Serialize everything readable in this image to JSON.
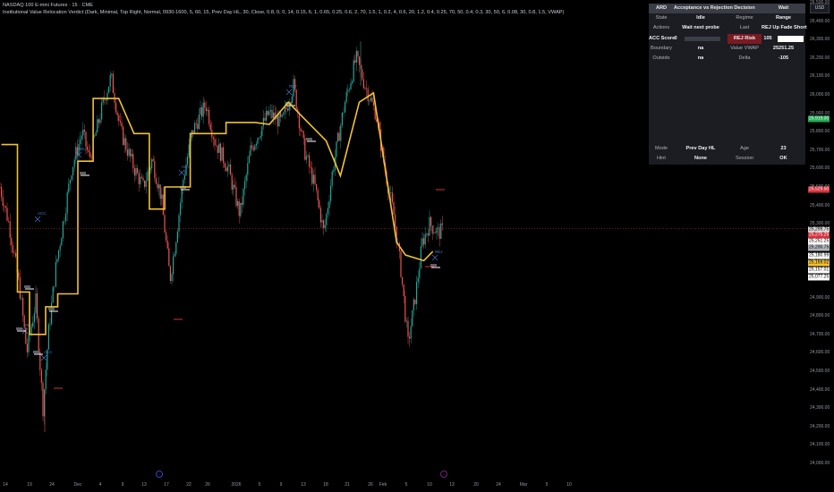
{
  "header": {
    "title": "NASDAQ 100 E-mini Futures · 15 · CME",
    "indicator": "Institutional Value Relocation Verdict (Dark, Minimal, Top Right, Normal, 0930-1600, 5, 60, 15, Prev Day HL, 30, Close, 0.8, 0, 0, 14, 0.15, 6, 1, 0.65, 0.25, 0.6, 2, 70, 1.5, 1, 0.2, 4, 0.6, 20, 1.2, 0.4, 0.25, 70, 50, 0.4, 0.3, 30, 50, 6, 0.08, 30, 0.8, 1.5, VWAP)"
  },
  "currency_button": "USD",
  "table": {
    "headers": [
      "ARD",
      "Acceptance vs Rejection",
      "Decision",
      "Wait"
    ],
    "rows": [
      [
        "State",
        "Idle",
        "Regime",
        "Range"
      ],
      [
        "Actions",
        "Wait next probe",
        "Last",
        "REJ Up  Fade Short"
      ],
      [
        "ACC Score",
        "0",
        "REJ Risk",
        "105"
      ],
      [
        "Boundary",
        "na",
        "Value VWAP",
        "25251.25"
      ],
      [
        "Outside",
        "na",
        "Delta",
        "-105"
      ]
    ],
    "footer_rows": [
      [
        "Mode",
        "Prev Day HL",
        "Age",
        "23"
      ],
      [
        "Hint",
        "None",
        "Session",
        "OK"
      ]
    ]
  },
  "price_axis": {
    "ticks": [
      "26,500.00",
      "26,400.00",
      "26,300.00",
      "26,200.00",
      "26,100.00",
      "26,000.00",
      "25,900.00",
      "25,800.00",
      "25,700.00",
      "25,600.00",
      "25,500.00",
      "25,400.00",
      "25,300.00",
      "25,200.00",
      "25,100.00",
      "25,000.00",
      "24,900.00",
      "24,800.00",
      "24,700.00",
      "24,600.00",
      "24,500.00",
      "24,400.00",
      "24,300.00",
      "24,200.00",
      "24,100.00",
      "24,000.00"
    ],
    "tags": [
      {
        "label": "25,919.00",
        "bg": "#22ab56",
        "fg": "#ffffff"
      },
      {
        "label": "25,529.50",
        "bg": "#d4313c",
        "fg": "#ffffff"
      },
      {
        "label": "25,299.75",
        "bg": "#d9d9d9",
        "fg": "#000000"
      },
      {
        "label": "25,275.25",
        "bg": "#d4313c",
        "fg": "#ffffff"
      },
      {
        "label": "25,251.25",
        "bg": "#ffffff",
        "fg": "#000000"
      },
      {
        "label": "25,200.75",
        "bg": "#b0b3ba",
        "fg": "#000000"
      },
      {
        "label": "25,180.99",
        "bg": "#ffffff",
        "fg": "#000000"
      },
      {
        "label": "25,169.02",
        "bg": "#f1c232",
        "fg": "#000000"
      },
      {
        "label": "25,157.01",
        "bg": "#ffffff",
        "fg": "#000000"
      },
      {
        "label": "25,077.25",
        "bg": "#ffffff",
        "fg": "#000000"
      }
    ]
  },
  "time_axis": [
    "14",
    "19",
    "24",
    "Dec",
    "4",
    "9",
    "13",
    "17",
    "22",
    "26",
    "2026",
    "5",
    "9",
    "13",
    "18",
    "21",
    "26",
    "Feb",
    "5",
    "10",
    "13",
    "20",
    "24",
    "Mar",
    "5",
    "10"
  ],
  "chart_data": {
    "type": "line",
    "symbol": "NQ1!",
    "timeframe": "15",
    "ylim": [
      24000,
      26500
    ],
    "series": [
      {
        "color": "#f1c232",
        "x": [
          "Nov 13",
          "Nov 17",
          "Nov 17",
          "Nov 20",
          "Nov 20",
          "Nov 24",
          "Nov 24",
          "Nov 27",
          "Nov 27",
          "Dec 1",
          "Dec 1",
          "Dec 4",
          "Dec 4",
          "Dec 9",
          "Dec 9",
          "Dec 12",
          "Dec 12",
          "Dec 15",
          "Dec 15",
          "Dec 18",
          "Dec 18",
          "Dec 23",
          "Dec 23",
          "Dec 30",
          "Dec 30",
          "Jan 5",
          "Jan 5",
          "Jan 8",
          "Jan 8",
          "Jan 12",
          "Jan 12",
          "Jan 15",
          "Jan 15",
          "Jan 20",
          "Jan 20",
          "Jan 23",
          "Jan 23",
          "Jan 27",
          "Jan 27",
          "Jan 30",
          "Jan 30",
          "Feb 4",
          "Feb 4",
          "Feb 6",
          "Feb 6",
          "Feb 10",
          "Feb 10",
          "Feb 12"
        ],
        "values": [
          25730,
          25730,
          24930,
          24930,
          24700,
          24700,
          24850,
          24850,
          24920,
          24920,
          25640,
          25640,
          25980,
          25980,
          25980,
          25790,
          25790,
          25790,
          25380,
          25380,
          25500,
          25500,
          25790,
          25790,
          25850,
          25850,
          25850,
          25840,
          25840,
          25960,
          25960,
          25880,
          25880,
          25750,
          25750,
          25560,
          25560,
          25960,
          25960,
          26010,
          26010,
          25200,
          25200,
          25130,
          25130,
          25100,
          25100,
          25150
        ]
      }
    ],
    "price_range": {
      "high": 26290,
      "low": 24170,
      "last": 25275.25
    },
    "markers": [
      "REJ",
      "ACC",
      "REJ",
      "ACC",
      "REJ",
      "ACC",
      "REJ"
    ]
  }
}
